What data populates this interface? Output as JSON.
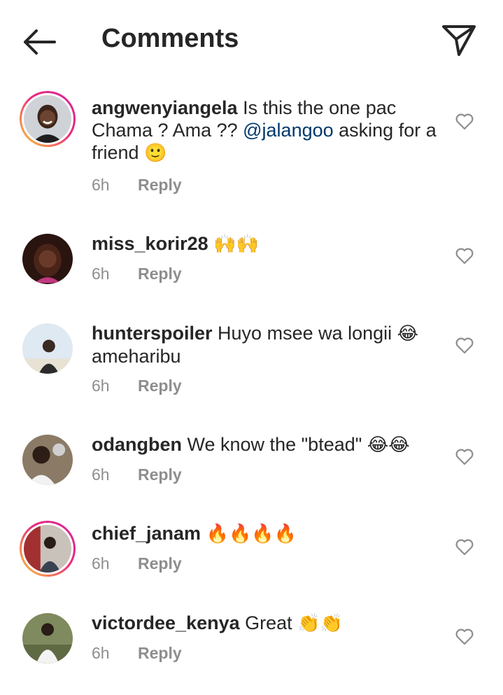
{
  "header": {
    "title": "Comments",
    "back_icon": "arrow-left-icon",
    "send_icon": "paper-plane-icon"
  },
  "comments": [
    {
      "username": "angwenyiangela",
      "text_before": "Is this the one pac Chama ? Ama ?? ",
      "mention": "@jalangoo",
      "text_after": "  asking for a friend ",
      "emoji": "🙂",
      "time": "6h",
      "reply": "Reply",
      "story_ring": true
    },
    {
      "username": "miss_korir28",
      "text_before": "",
      "mention": "",
      "text_after": "",
      "emoji": "🙌🙌",
      "time": "6h",
      "reply": "Reply",
      "story_ring": false
    },
    {
      "username": "hunterspoiler",
      "text_before": "Huyo msee wa longii ",
      "mention": "",
      "text_after": "",
      "emoji": "😂",
      "text_end": " ameharibu",
      "time": "6h",
      "reply": "Reply",
      "story_ring": false
    },
    {
      "username": "odangben",
      "text_before": "We know the \"btead\" ",
      "mention": "",
      "text_after": "",
      "emoji": "😂😂",
      "time": "6h",
      "reply": "Reply",
      "story_ring": false
    },
    {
      "username": "chief_janam",
      "text_before": "",
      "mention": "",
      "text_after": "",
      "emoji": "🔥🔥🔥🔥",
      "time": "6h",
      "reply": "Reply",
      "story_ring": true
    },
    {
      "username": "victordee_kenya",
      "text_before": "Great ",
      "mention": "",
      "text_after": "",
      "emoji": "👏👏",
      "time": "6h",
      "reply": "Reply",
      "story_ring": false
    }
  ]
}
